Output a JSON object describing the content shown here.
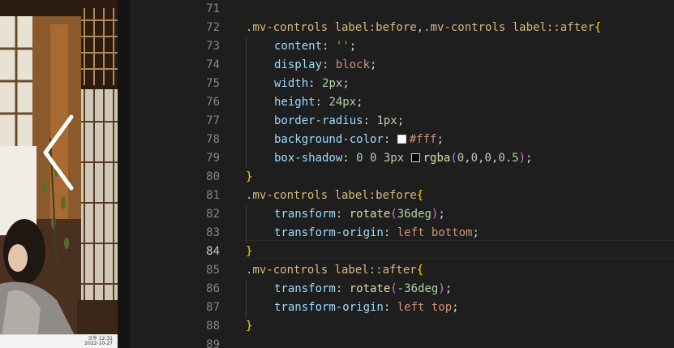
{
  "preview": {
    "clock_time": "오후 12:31",
    "clock_date": "2022-10-27",
    "nav_icon": "chevron-left-icon"
  },
  "editor": {
    "active_line": "84",
    "colors": {
      "white_swatch": "#ffffff",
      "shadow_swatch": "#000000"
    },
    "lines": [
      {
        "num": "71",
        "tokens": []
      },
      {
        "num": "72",
        "tokens": [
          {
            "t": ".mv-controls label:before",
            "c": "sel"
          },
          {
            "t": ",",
            "c": "punct"
          },
          {
            "t": ".mv-controls label::after",
            "c": "sel"
          },
          {
            "t": "{",
            "c": "brace"
          }
        ]
      },
      {
        "num": "73",
        "indent": true,
        "tokens": [
          {
            "t": "content",
            "c": "prop"
          },
          {
            "t": ": ",
            "c": "punct"
          },
          {
            "t": "''",
            "c": "str"
          },
          {
            "t": ";",
            "c": "punct"
          }
        ]
      },
      {
        "num": "74",
        "indent": true,
        "tokens": [
          {
            "t": "display",
            "c": "prop"
          },
          {
            "t": ": ",
            "c": "punct"
          },
          {
            "t": "block",
            "c": "str"
          },
          {
            "t": ";",
            "c": "punct"
          }
        ]
      },
      {
        "num": "75",
        "indent": true,
        "tokens": [
          {
            "t": "width",
            "c": "prop"
          },
          {
            "t": ": ",
            "c": "punct"
          },
          {
            "t": "2px",
            "c": "num"
          },
          {
            "t": ";",
            "c": "punct"
          }
        ]
      },
      {
        "num": "76",
        "indent": true,
        "tokens": [
          {
            "t": "height",
            "c": "prop"
          },
          {
            "t": ": ",
            "c": "punct"
          },
          {
            "t": "24px",
            "c": "num"
          },
          {
            "t": ";",
            "c": "punct"
          }
        ]
      },
      {
        "num": "77",
        "indent": true,
        "tokens": [
          {
            "t": "border-radius",
            "c": "prop"
          },
          {
            "t": ": ",
            "c": "punct"
          },
          {
            "t": "1px",
            "c": "num"
          },
          {
            "t": ";",
            "c": "punct"
          }
        ]
      },
      {
        "num": "78",
        "indent": true,
        "tokens": [
          {
            "t": "background-color",
            "c": "prop"
          },
          {
            "t": ": ",
            "c": "punct"
          },
          {
            "swatch": "white_swatch"
          },
          {
            "t": "#fff",
            "c": "str"
          },
          {
            "t": ";",
            "c": "punct"
          }
        ]
      },
      {
        "num": "79",
        "indent": true,
        "tokens": [
          {
            "t": "box-shadow",
            "c": "prop"
          },
          {
            "t": ": ",
            "c": "punct"
          },
          {
            "t": "0 0 3px ",
            "c": "num"
          },
          {
            "swatch": "shadow_swatch"
          },
          {
            "t": "rgba",
            "c": "fn"
          },
          {
            "t": "(",
            "c": "paren"
          },
          {
            "t": "0,0,0,0.5",
            "c": "num"
          },
          {
            "t": ")",
            "c": "paren"
          },
          {
            "t": ";",
            "c": "punct"
          }
        ]
      },
      {
        "num": "80",
        "tokens": [
          {
            "t": "}",
            "c": "brace"
          }
        ]
      },
      {
        "num": "81",
        "tokens": [
          {
            "t": ".mv-controls label:before",
            "c": "sel"
          },
          {
            "t": "{",
            "c": "brace"
          }
        ]
      },
      {
        "num": "82",
        "indent": true,
        "tokens": [
          {
            "t": "transform",
            "c": "prop"
          },
          {
            "t": ": ",
            "c": "punct"
          },
          {
            "t": "rotate",
            "c": "fn"
          },
          {
            "t": "(",
            "c": "paren"
          },
          {
            "t": "36deg",
            "c": "num"
          },
          {
            "t": ")",
            "c": "paren"
          },
          {
            "t": ";",
            "c": "punct"
          }
        ]
      },
      {
        "num": "83",
        "indent": true,
        "tokens": [
          {
            "t": "transform-origin",
            "c": "prop"
          },
          {
            "t": ": ",
            "c": "punct"
          },
          {
            "t": "left bottom",
            "c": "str"
          },
          {
            "t": ";",
            "c": "punct"
          }
        ]
      },
      {
        "num": "84",
        "tokens": [
          {
            "t": "}",
            "c": "brace"
          }
        ]
      },
      {
        "num": "85",
        "tokens": [
          {
            "t": ".mv-controls label::after",
            "c": "sel"
          },
          {
            "t": "{",
            "c": "brace"
          }
        ]
      },
      {
        "num": "86",
        "indent": true,
        "tokens": [
          {
            "t": "transform",
            "c": "prop"
          },
          {
            "t": ": ",
            "c": "punct"
          },
          {
            "t": "rotate",
            "c": "fn"
          },
          {
            "t": "(",
            "c": "paren"
          },
          {
            "t": "-36deg",
            "c": "num"
          },
          {
            "t": ")",
            "c": "paren"
          },
          {
            "t": ";",
            "c": "punct"
          }
        ]
      },
      {
        "num": "87",
        "indent": true,
        "tokens": [
          {
            "t": "transform-origin",
            "c": "prop"
          },
          {
            "t": ": ",
            "c": "punct"
          },
          {
            "t": "left top",
            "c": "str"
          },
          {
            "t": ";",
            "c": "punct"
          }
        ]
      },
      {
        "num": "88",
        "tokens": [
          {
            "t": "}",
            "c": "brace"
          }
        ]
      },
      {
        "num": "89",
        "tokens": []
      }
    ]
  }
}
